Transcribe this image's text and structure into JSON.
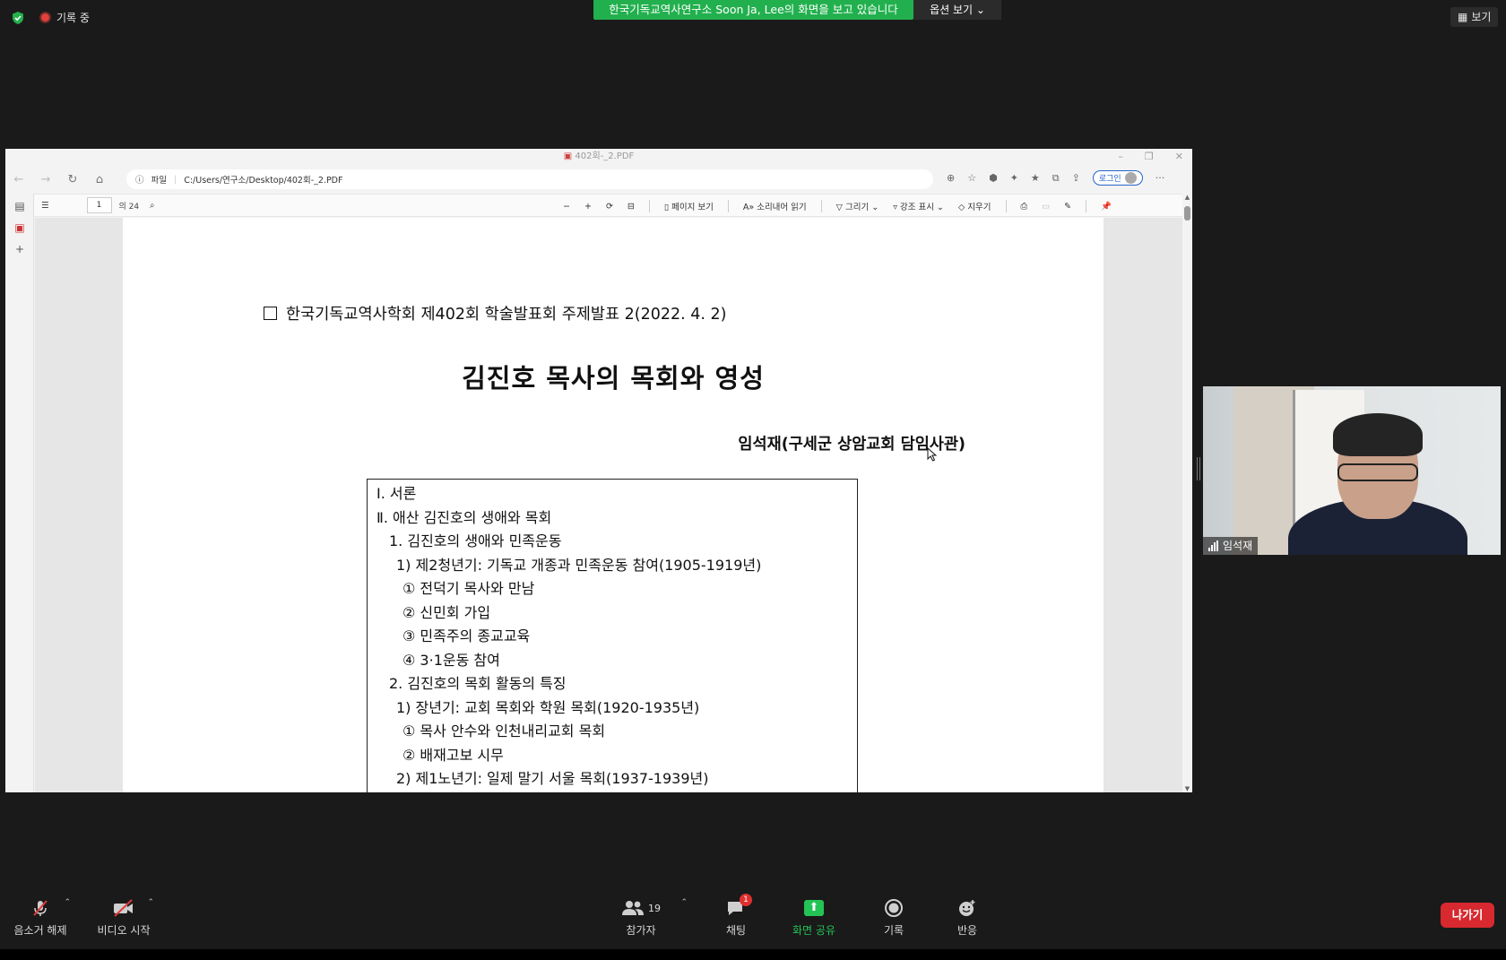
{
  "top": {
    "recording_label": "기록 중",
    "share_banner": "한국기독교역사연구소 Soon Ja, Lee의 화면을 보고 있습니다",
    "view_options": "옵션 보기",
    "view_button": "보기"
  },
  "browser": {
    "tab_title": "402회-_2.PDF",
    "address_scheme": "파일",
    "address_path": "C:/Users/연구소/Desktop/402회-_2.PDF",
    "login": "로그인"
  },
  "pdf_toolbar": {
    "page_number": "1",
    "page_total": "의 24",
    "page_view": "페이지 보기",
    "read_aloud": "소리내어 읽기",
    "draw": "그리기",
    "highlight": "강조 표시",
    "erase": "지우기"
  },
  "document": {
    "conference_line": "한국기독교역사학회 제402회 학술발표회 주제발표 2(2022. 4. 2)",
    "title": "김진호 목사의 목회와 영성",
    "author": "임석재(구세군 상암교회 담임사관)",
    "toc": [
      "Ⅰ. 서론",
      "Ⅱ. 애산 김진호의 생애와 목회",
      "  1. 김진호의 생애와 민족운동",
      "   1) 제2청년기: 기독교 개종과 민족운동 참여(1905-1919년)",
      "    ① 전덕기 목사와 만남",
      "    ② 신민회 가입",
      "    ③ 민족주의 종교교육",
      "    ④ 3·1운동 참여",
      "  2. 김진호의 목회 활동의 특징",
      "   1) 장년기: 교회 목회와 학원 목회(1920-1935년)",
      "    ① 목사 안수와 인천내리교회 목회",
      "    ② 배재고보 시무",
      "   2) 제1노년기: 일제 말기 서울 목회(1937-1939년)"
    ]
  },
  "video": {
    "participant_name": "임석재"
  },
  "bottom": {
    "mute": "음소거 해제",
    "video": "비디오 시작",
    "participants": "참가자",
    "participant_count": "19",
    "chat": "채팅",
    "chat_badge": "1",
    "share": "화면 공유",
    "record": "기록",
    "reactions": "반응",
    "leave": "나가기"
  },
  "colors": {
    "banner_green": "#22b04e",
    "leave_red": "#d7292f",
    "share_green": "#24c356"
  }
}
